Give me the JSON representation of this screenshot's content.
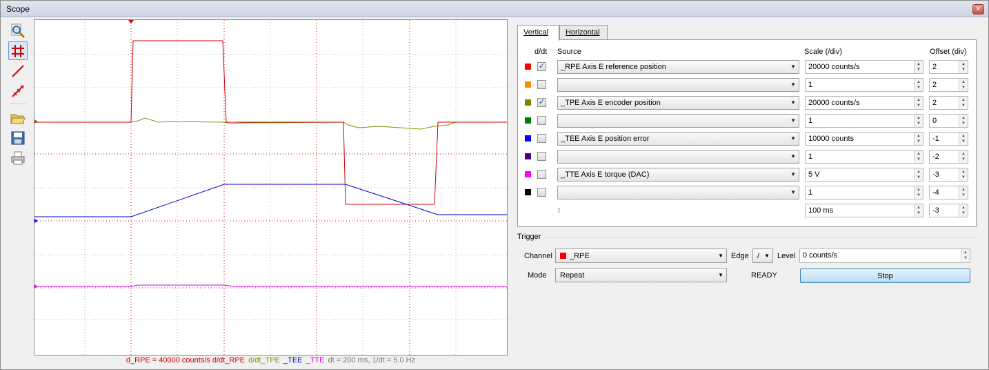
{
  "window": {
    "title": "Scope",
    "close": "✕"
  },
  "toolbar": {
    "tools": [
      "zoom-icon",
      "grid-icon",
      "line-icon",
      "cursor-icon",
      "open-folder-icon",
      "save-icon",
      "print-icon"
    ]
  },
  "legend": {
    "parts": [
      {
        "text": "d_RPE = 40000 counts/s d/dt_RPE",
        "color": "#d00000"
      },
      {
        "text": "d/dt_TPE",
        "color": "#8b8b00"
      },
      {
        "text": "_TEE",
        "color": "#0000c8"
      },
      {
        "text": "_TTE",
        "color": "#e000e0"
      },
      {
        "text": "dt = 200 ms, 1/dt = 5.0 Hz",
        "color": "#7a7a7a"
      }
    ]
  },
  "tabs": {
    "vertical": "Vertical",
    "horizontal": "Horizontal"
  },
  "headers": {
    "ddt": "d/dt",
    "source": "Source",
    "scale": "Scale (/div)",
    "offset": "Offset (div)"
  },
  "channels": [
    {
      "color": "#ff0000",
      "ddt": true,
      "source": "_RPE Axis E reference position",
      "scale": "20000 counts/s",
      "offset": "2"
    },
    {
      "color": "#ff8c00",
      "ddt": false,
      "source": "",
      "scale": "1",
      "offset": "2"
    },
    {
      "color": "#808000",
      "ddt": true,
      "source": "_TPE Axis E encoder position",
      "scale": "20000 counts/s",
      "offset": "2"
    },
    {
      "color": "#008000",
      "ddt": false,
      "source": "",
      "scale": "1",
      "offset": "0"
    },
    {
      "color": "#0000ff",
      "ddt": false,
      "source": "_TEE Axis E position error",
      "scale": "10000 counts",
      "offset": "-1"
    },
    {
      "color": "#4b0082",
      "ddt": false,
      "source": "",
      "scale": "1",
      "offset": "-2"
    },
    {
      "color": "#ff00ff",
      "ddt": false,
      "source": "_TTE Axis E torque (DAC)",
      "scale": "5 V",
      "offset": "-3"
    },
    {
      "color": "#000000",
      "ddt": false,
      "source": "",
      "scale": "1",
      "offset": "-4"
    }
  ],
  "time_row": {
    "label": "t",
    "scale": "100 ms",
    "offset": "-3"
  },
  "trigger": {
    "title": "Trigger",
    "channel_label": "Channel",
    "channel_value": "_RPE",
    "channel_color": "#ff0000",
    "edge_label": "Edge",
    "edge_value": "/",
    "level_label": "Level",
    "level_value": "0 counts/s",
    "mode_label": "Mode",
    "mode_value": "Repeat",
    "status": "READY",
    "stop_label": "Stop"
  }
}
